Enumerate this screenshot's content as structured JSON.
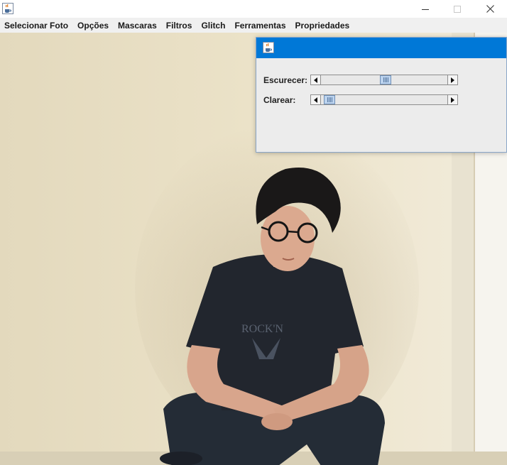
{
  "window": {
    "icon": "java-coffee-icon",
    "controls": [
      "minimize-icon",
      "maximize-icon",
      "close-icon"
    ]
  },
  "menu": {
    "items": [
      "Selecionar Foto",
      "Opções",
      "Mascaras",
      "Filtros",
      "Glitch",
      "Ferramentas",
      "Propriedades"
    ]
  },
  "dialog": {
    "icon": "java-coffee-icon",
    "title_bar_color": "#0078d7",
    "sliders": [
      {
        "label": "Escurecer:",
        "value_fraction": 0.51
      },
      {
        "label": "Clarear:",
        "value_fraction": 0.02
      }
    ]
  },
  "photo": {
    "subject": "young man with glasses crouching against a cream wall",
    "wall_color": "#e6dcc0"
  }
}
